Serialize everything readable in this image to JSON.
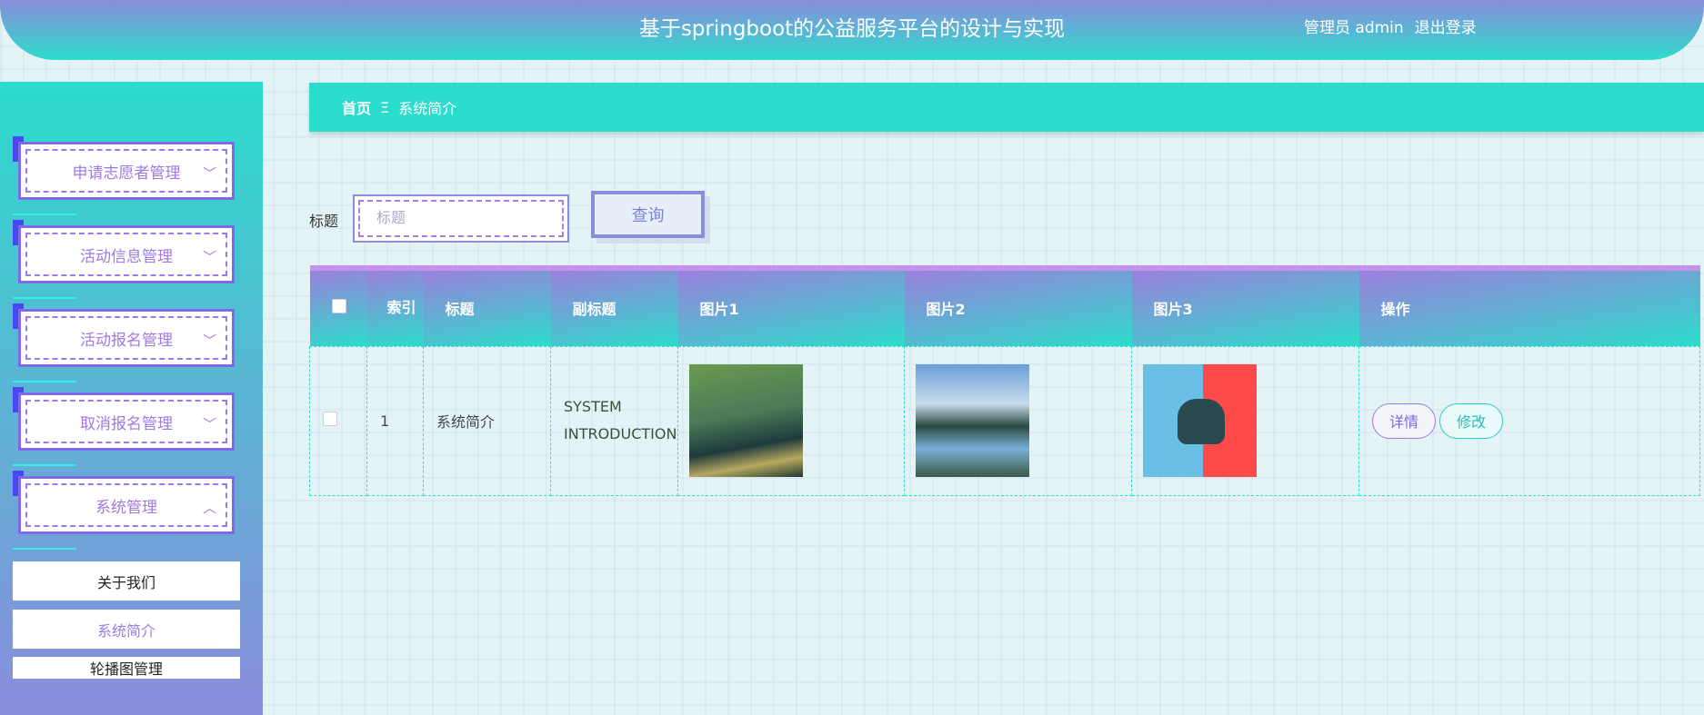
{
  "header": {
    "title": "基于springboot的公益服务平台的设计与实现",
    "role": "管理员 admin",
    "logout": "退出登录"
  },
  "sidebar": {
    "menus": [
      {
        "label": "申请志愿者管理",
        "chevron": "chevron-down-icon"
      },
      {
        "label": "活动信息管理",
        "chevron": "chevron-down-icon"
      },
      {
        "label": "活动报名管理",
        "chevron": "chevron-down-icon"
      },
      {
        "label": "取消报名管理",
        "chevron": "chevron-down-icon"
      },
      {
        "label": "系统管理",
        "chevron": "chevron-up-icon"
      }
    ],
    "submenu": [
      {
        "label": "关于我们"
      },
      {
        "label": "系统简介"
      },
      {
        "label": "轮播图管理"
      }
    ]
  },
  "breadcrumb": {
    "home": "首页",
    "sep": "Ξ",
    "current": "系统简介"
  },
  "search": {
    "label": "标题",
    "placeholder": "标题",
    "button": "查询"
  },
  "table": {
    "headers": [
      "索引",
      "标题",
      "副标题",
      "图片1",
      "图片2",
      "图片3",
      "操作"
    ],
    "rows": [
      {
        "index": "1",
        "title": "系统简介",
        "subtitle": "SYSTEM INTRODUCTION",
        "detail": "详情",
        "edit": "修改"
      }
    ]
  }
}
